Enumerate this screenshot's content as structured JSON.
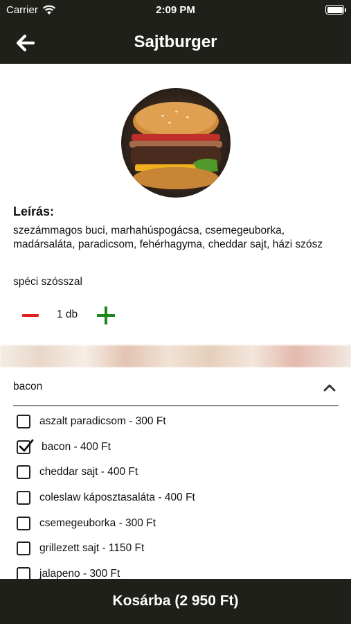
{
  "status_bar": {
    "carrier": "Carrier",
    "time": "2:09 PM"
  },
  "nav": {
    "title": "Sajtburger"
  },
  "product": {
    "description_heading": "Leírás:",
    "description": "szezámmagos buci, marhahúspogácsa, csemegeuborka, madársaláta, paradicsom, fehérhagyma, cheddar sajt, házi szósz",
    "note": "spéci szósszal",
    "quantity_label": "1 db"
  },
  "addons": {
    "selected_value": "bacon",
    "options": [
      {
        "label": "aszalt paradicsom - 300 Ft",
        "checked": false
      },
      {
        "label": "bacon - 400 Ft",
        "checked": true
      },
      {
        "label": "cheddar sajt - 400 Ft",
        "checked": false
      },
      {
        "label": "coleslaw káposztasaláta - 400 Ft",
        "checked": false
      },
      {
        "label": "csemegeuborka - 300 Ft",
        "checked": false
      },
      {
        "label": "grillezett sajt - 1150 Ft",
        "checked": false
      },
      {
        "label": "jalapeno - 300 Ft",
        "checked": false
      }
    ]
  },
  "cart": {
    "button_label": "Kosárba (2 950 Ft)"
  },
  "colors": {
    "bar": "#1f2019",
    "minus": "#e02020",
    "plus": "#1a8a1a"
  }
}
